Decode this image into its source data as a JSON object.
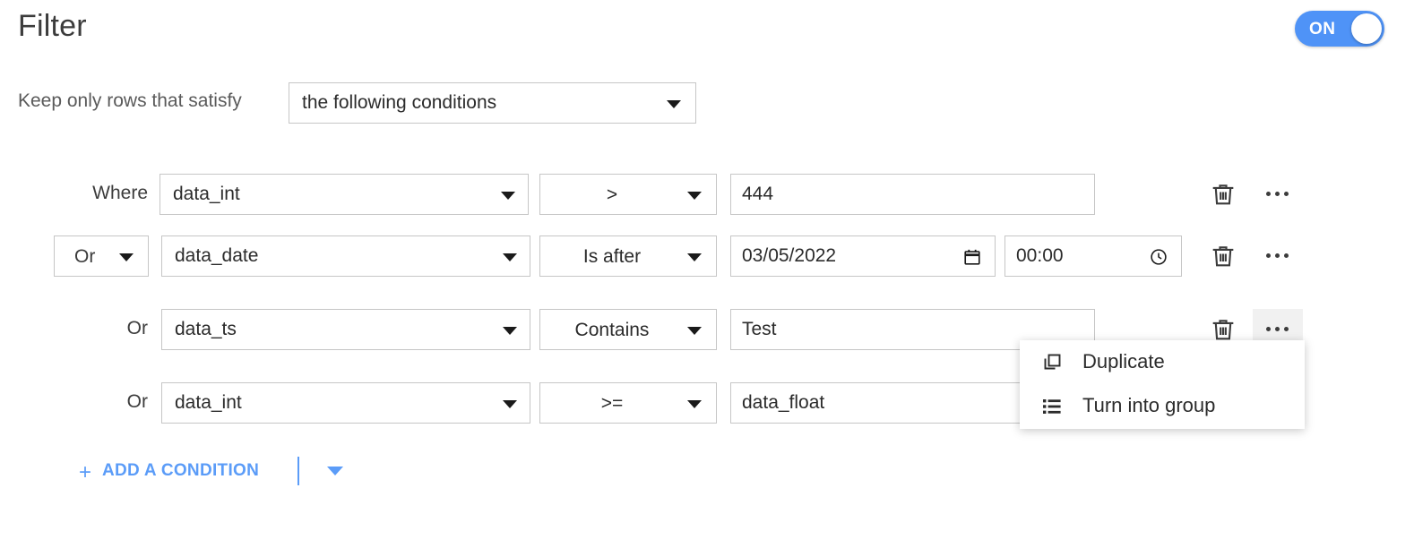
{
  "header": {
    "title": "Filter",
    "toggle": {
      "label": "ON",
      "state": "on",
      "color": "#4f93f7"
    }
  },
  "satisfy": {
    "label": "Keep only rows that satisfy",
    "select_value": "the following conditions"
  },
  "conditions": {
    "rows": [
      {
        "conjunction": "Where",
        "conjunction_is_select": false,
        "field": "data_int",
        "operator": ">",
        "value": "444",
        "value_kind": "text"
      },
      {
        "conjunction": "Or",
        "conjunction_is_select": true,
        "field": "data_date",
        "operator": "Is after",
        "date_value": "03/05/2022",
        "time_value": "00:00",
        "value_kind": "datetime"
      },
      {
        "conjunction": "Or",
        "conjunction_is_select": false,
        "field": "data_ts",
        "operator": "Contains",
        "value": "Test",
        "value_kind": "text"
      },
      {
        "conjunction": "Or",
        "conjunction_is_select": false,
        "field": "data_int",
        "operator": ">=",
        "value": "data_float",
        "value_kind": "text"
      }
    ],
    "delete_icon": "trash-icon",
    "more_icon": "ellipsis-icon"
  },
  "context_menu": {
    "items": [
      {
        "label": "Duplicate",
        "icon": "duplicate-icon"
      },
      {
        "label": "Turn into group",
        "icon": "list-icon"
      }
    ]
  },
  "add_condition": {
    "plus": "+",
    "label": "ADD A CONDITION",
    "color": "#5b9cf8"
  }
}
